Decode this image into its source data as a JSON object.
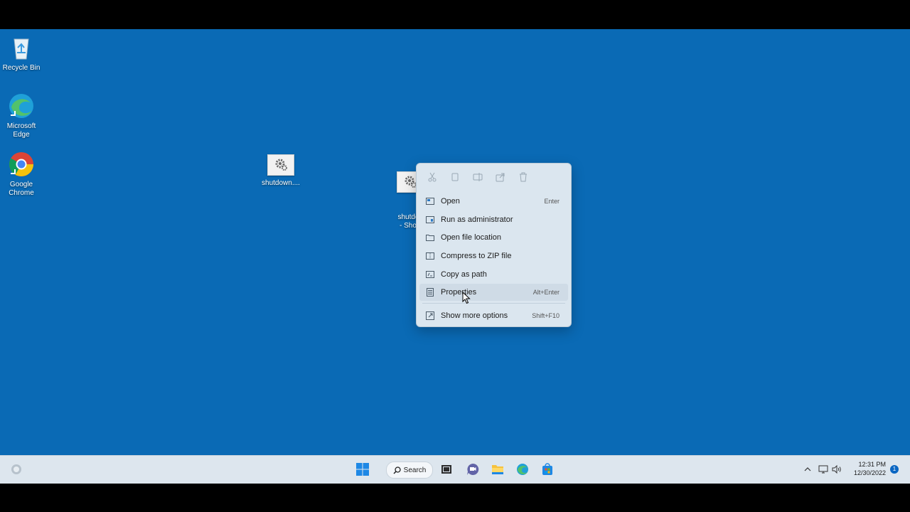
{
  "desktop": {
    "icons": [
      {
        "label": "Recycle Bin"
      },
      {
        "label": "Microsoft Edge"
      },
      {
        "label": "Google Chrome"
      },
      {
        "label": "shutdown...."
      },
      {
        "label": "shutdov\n- Short"
      }
    ]
  },
  "context_menu": {
    "toolbar": [
      "cut-icon",
      "copy-icon",
      "rename-icon",
      "share-icon",
      "delete-icon"
    ],
    "items": [
      {
        "label": "Open",
        "shortcut": "Enter",
        "icon": "open-icon"
      },
      {
        "label": "Run as administrator",
        "shortcut": "",
        "icon": "shield-icon"
      },
      {
        "label": "Open file location",
        "shortcut": "",
        "icon": "folder-icon"
      },
      {
        "label": "Compress to ZIP file",
        "shortcut": "",
        "icon": "zip-icon"
      },
      {
        "label": "Copy as path",
        "shortcut": "",
        "icon": "path-icon"
      },
      {
        "label": "Properties",
        "shortcut": "Alt+Enter",
        "icon": "properties-icon"
      },
      {
        "label": "Show more options",
        "shortcut": "Shift+F10",
        "icon": "more-options-icon"
      }
    ]
  },
  "taskbar": {
    "search_label": "Search",
    "clock_time": "12:31 PM",
    "clock_date": "12/30/2022",
    "notification_count": "1"
  },
  "colors": {
    "desktop_bg": "#0a6ab5",
    "taskbar_bg": "#dde6ee",
    "menu_bg": "#dbe6ef"
  }
}
